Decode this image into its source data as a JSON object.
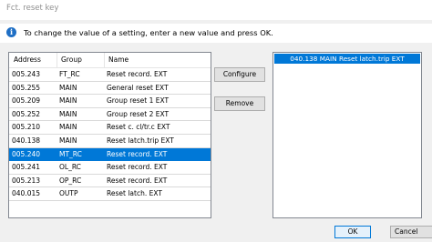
{
  "window": {
    "title": "Fct. reset key"
  },
  "info": {
    "icon": "info-icon",
    "text": "To change the value of a setting, enter a new value and press OK."
  },
  "table": {
    "headers": {
      "address": "Address",
      "group": "Group",
      "name": "Name"
    },
    "rows": [
      {
        "address": "005.243",
        "group": "FT_RC",
        "name": "Reset record. EXT"
      },
      {
        "address": "005.255",
        "group": "MAIN",
        "name": "General reset EXT"
      },
      {
        "address": "005.209",
        "group": "MAIN",
        "name": "Group reset 1 EXT"
      },
      {
        "address": "005.252",
        "group": "MAIN",
        "name": "Group reset 2 EXT"
      },
      {
        "address": "005.210",
        "group": "MAIN",
        "name": "Reset c. cl/tr.c EXT"
      },
      {
        "address": "040.138",
        "group": "MAIN",
        "name": "Reset latch.trip EXT"
      },
      {
        "address": "005.240",
        "group": "MT_RC",
        "name": "Reset record. EXT"
      },
      {
        "address": "005.241",
        "group": "OL_RC",
        "name": "Reset record. EXT"
      },
      {
        "address": "005.213",
        "group": "OP_RC",
        "name": "Reset record. EXT"
      },
      {
        "address": "040.015",
        "group": "OUTP",
        "name": "Reset latch. EXT"
      }
    ]
  },
  "buttons": {
    "configure": "Configure",
    "remove": "Remove",
    "ok": "OK",
    "cancel": "Cancel"
  },
  "selected": {
    "items": [
      "040.138 MAIN   Reset latch.trip EXT"
    ]
  },
  "colors": {
    "selection": "#0078d7",
    "info_icon": "#1f6fc5"
  }
}
